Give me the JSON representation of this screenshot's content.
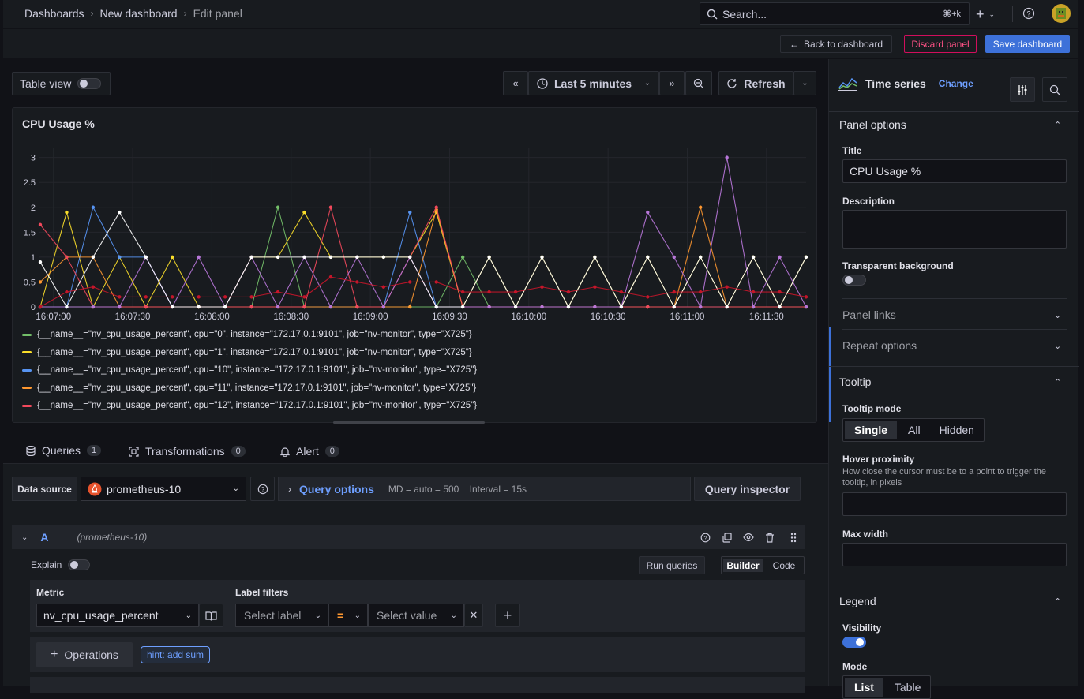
{
  "breadcrumb": {
    "items": [
      "Dashboards",
      "New dashboard",
      "Edit panel"
    ]
  },
  "search": {
    "placeholder": "Search...",
    "shortcut": "⌘+k"
  },
  "actions": {
    "back": "Back to dashboard",
    "discard": "Discard panel",
    "save": "Save dashboard"
  },
  "toolbar": {
    "table_view": "Table view",
    "time_range": "Last 5 minutes",
    "refresh": "Refresh"
  },
  "chart_data": {
    "type": "line",
    "title": "CPU Usage %",
    "x": [
      "16:06:45",
      "16:06:55",
      "16:07:05",
      "16:07:15",
      "16:07:25",
      "16:07:35",
      "16:07:45",
      "16:07:55",
      "16:08:05",
      "16:08:15",
      "16:08:25",
      "16:08:35",
      "16:08:45",
      "16:08:55",
      "16:09:05",
      "16:09:15",
      "16:09:25",
      "16:09:35",
      "16:09:45",
      "16:09:55",
      "16:10:05",
      "16:10:15",
      "16:10:25",
      "16:10:35",
      "16:10:45",
      "16:10:55",
      "16:11:05",
      "16:11:15",
      "16:11:25",
      "16:11:35"
    ],
    "x_ticks": [
      "16:07:00",
      "16:07:30",
      "16:08:00",
      "16:08:30",
      "16:09:00",
      "16:09:30",
      "16:10:00",
      "16:10:30",
      "16:11:00",
      "16:11:30"
    ],
    "ylim": [
      0,
      3.2
    ],
    "y_ticks": [
      "0",
      "0.5",
      "1",
      "1.5",
      "2",
      "2.5",
      "3"
    ],
    "series": [
      {
        "name": "{__name__=\"nv_cpu_usage_percent\", cpu=\"0\", instance=\"172.17.0.1:9101\", job=\"nv-monitor\", type=\"X725\"}",
        "color": "#73bf69",
        "values": [
          0,
          0,
          0,
          0,
          0,
          0,
          0,
          0,
          0,
          2,
          0,
          0,
          0,
          0,
          0,
          0,
          1,
          0,
          0,
          0,
          0,
          0,
          0,
          0,
          0,
          0,
          0,
          0,
          0,
          0
        ]
      },
      {
        "name": "{__name__=\"nv_cpu_usage_percent\", cpu=\"1\", instance=\"172.17.0.1:9101\", job=\"nv-monitor\", type=\"X725\"}",
        "color": "#fade2a",
        "values": [
          0,
          1.9,
          0,
          1,
          0,
          1,
          0,
          0,
          1,
          1,
          1.9,
          1,
          1,
          1,
          1,
          1.9,
          0,
          1,
          0,
          1,
          0,
          1,
          0,
          1,
          0,
          1,
          0,
          1,
          0,
          1
        ]
      },
      {
        "name": "{__name__=\"nv_cpu_usage_percent\", cpu=\"10\", instance=\"172.17.0.1:9101\", job=\"nv-monitor\", type=\"X725\"}",
        "color": "#5794f2",
        "values": [
          0,
          0,
          2,
          1,
          1,
          0,
          0,
          0,
          0,
          0,
          0,
          0,
          0,
          0,
          1.9,
          0,
          0,
          0,
          0,
          0,
          0,
          0,
          0,
          0,
          0,
          0,
          0,
          0,
          0,
          0
        ]
      },
      {
        "name": "{__name__=\"nv_cpu_usage_percent\", cpu=\"11\", instance=\"172.17.0.1:9101\", job=\"nv-monitor\", type=\"X725\"}",
        "color": "#ff9830",
        "values": [
          0.5,
          1,
          1,
          0,
          0,
          0,
          0,
          0,
          0,
          0,
          0,
          0,
          0,
          0,
          0,
          1.95,
          0,
          0,
          0,
          0,
          0,
          0,
          0,
          0,
          0,
          2,
          0,
          0,
          0,
          0
        ]
      },
      {
        "name": "{__name__=\"nv_cpu_usage_percent\", cpu=\"12\", instance=\"172.17.0.1:9101\", job=\"nv-monitor\", type=\"X725\"}",
        "color": "#f2495c",
        "values": [
          1.65,
          1,
          0,
          0,
          0,
          0,
          0,
          0,
          0,
          0,
          0,
          2,
          0,
          0,
          1,
          2,
          0,
          0,
          0,
          0,
          0,
          0,
          0,
          0,
          0,
          0,
          0,
          0,
          0,
          0
        ]
      },
      {
        "name": "",
        "color": "#b877d9",
        "values": [
          0,
          0,
          0,
          0,
          1,
          0,
          1,
          0,
          1,
          0,
          1,
          0,
          1,
          0,
          1,
          0,
          0,
          0,
          0,
          0,
          0,
          0,
          0,
          1.9,
          1,
          0,
          3,
          0,
          1,
          0
        ]
      },
      {
        "name": "",
        "color": "#ffffff",
        "values": [
          0.9,
          0,
          1,
          1.9,
          1,
          0,
          0,
          0,
          1,
          1,
          1,
          1,
          1,
          1,
          1,
          0,
          0,
          1,
          0,
          1,
          0,
          1,
          0,
          1,
          0,
          1,
          0,
          1,
          0,
          1
        ]
      },
      {
        "name": "",
        "color": "#c4162a",
        "values": [
          0,
          0.3,
          0.4,
          0.2,
          0.2,
          0.2,
          0.2,
          0.2,
          0.2,
          0.3,
          0.2,
          0.6,
          0.5,
          0.4,
          0.5,
          0.5,
          0.3,
          0.3,
          0.3,
          0.4,
          0.3,
          0.4,
          0.3,
          0.2,
          0.3,
          0.3,
          0.4,
          0.3,
          0.3,
          0.2
        ]
      }
    ],
    "legend_placement": "bottom",
    "grid": true
  },
  "query_tabs": [
    {
      "label": "Queries",
      "count": "1"
    },
    {
      "label": "Transformations",
      "count": "0"
    },
    {
      "label": "Alert",
      "count": "0"
    }
  ],
  "query": {
    "datasource_label": "Data source",
    "datasource": "prometheus-10",
    "query_options": "Query options",
    "query_options_meta": "MD = auto = 500    Interval = 15s",
    "inspector": "Query inspector",
    "ref_id": "A",
    "ref_source": "(prometheus-10)",
    "explain": "Explain",
    "run": "Run queries",
    "builder": "Builder",
    "code": "Code",
    "metric_label": "Metric",
    "metric_value": "nv_cpu_usage_percent",
    "label_filters": "Label filters",
    "select_label": "Select label",
    "operator": "=",
    "select_value": "Select value",
    "operations": "Operations",
    "hint": "hint: add sum"
  },
  "sidebar": {
    "viz_name": "Time series",
    "change": "Change",
    "panel_options": "Panel options",
    "title_label": "Title",
    "title_value": "CPU Usage %",
    "description_label": "Description",
    "transparent_label": "Transparent background",
    "panel_links": "Panel links",
    "repeat_options": "Repeat options",
    "tooltip": "Tooltip",
    "tooltip_mode": "Tooltip mode",
    "tooltip_modes": [
      "Single",
      "All",
      "Hidden"
    ],
    "hover_proximity": "Hover proximity",
    "hover_desc": "How close the cursor must be to a point to trigger the tooltip, in pixels",
    "max_width": "Max width",
    "legend": "Legend",
    "visibility": "Visibility",
    "mode": "Mode",
    "modes": [
      "List",
      "Table"
    ]
  }
}
